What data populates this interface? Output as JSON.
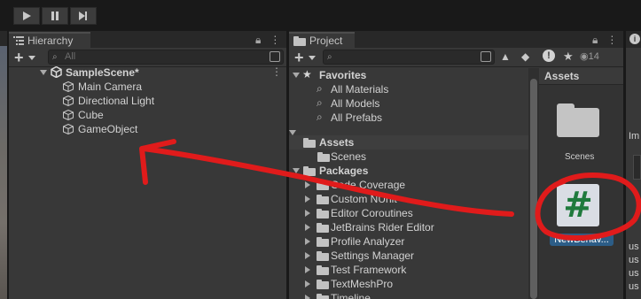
{
  "hierarchy": {
    "tab_label": "Hierarchy",
    "search_placeholder": "All",
    "scene_name": "SampleScene*",
    "objects": [
      "Main Camera",
      "Directional Light",
      "Cube",
      "GameObject"
    ]
  },
  "project": {
    "tab_label": "Project",
    "hidden_count": "14",
    "favorites": {
      "label": "Favorites",
      "items": [
        "All Materials",
        "All Models",
        "All Prefabs"
      ]
    },
    "assets": {
      "label": "Assets",
      "items": [
        "Scenes"
      ]
    },
    "packages": {
      "label": "Packages",
      "items": [
        "Code Coverage",
        "Custom NUnit",
        "Editor Coroutines",
        "JetBrains Rider Editor",
        "Profile Analyzer",
        "Settings Manager",
        "Test Framework",
        "TextMeshPro",
        "Timeline"
      ]
    },
    "assets_pane": {
      "header": "Assets",
      "items": [
        {
          "name": "Scenes",
          "icon": "folder-icon"
        },
        {
          "name": "NewBehav...",
          "icon": "csharp-script-icon",
          "selected": true
        }
      ]
    }
  },
  "inspector": {
    "partial_labels": [
      "Im",
      "us",
      "us",
      "us",
      "us"
    ]
  },
  "annotation": {
    "color": "#e01b1b",
    "description_shapes": [
      "red-circle",
      "red-arrow"
    ]
  }
}
